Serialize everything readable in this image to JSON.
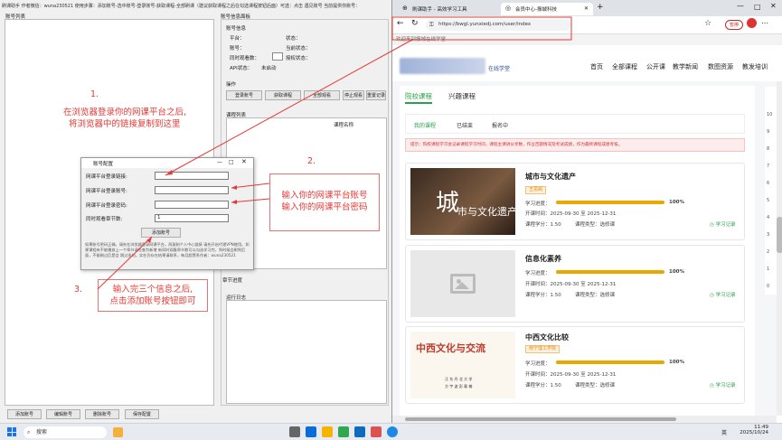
{
  "app": {
    "title": "刷课助手 作者微信：wuna230521  使用步骤：添加账号-选中账号-登录账号-获取课程-全部刷课（建议获取课程之后在勾选课程按钮后面）可选：点击 遇见账号 当前提供你账号：",
    "list_label": "账号列表",
    "settings_label": "账号信息面板",
    "info_label": "账号信息",
    "platform": "平台：",
    "account": "账号：",
    "sync_count": "同时观看数：",
    "api_status": "API状态：",
    "api_value": "未启动",
    "status": "状态：",
    "current_status": "当前状态：",
    "auth_status": "授权状态：",
    "ops_label": "操作",
    "ops": [
      "登录账号",
      "获取课程",
      "全部观看",
      "停止观看",
      "重置记录"
    ],
    "course_list_label": "课程列表",
    "course_name_col": "课程名称",
    "chapter_label": "章节进度",
    "log_label": "运行日志",
    "bottom_buttons": [
      "添加账号",
      "编辑账号",
      "删除账号",
      "保存配置"
    ]
  },
  "dialog": {
    "title": "账号配置",
    "fields": [
      "网课平台登录链接:",
      "网课平台登录账号:",
      "网课平台登录密码:",
      "同时观看章节数:"
    ],
    "chapter_value": "1",
    "add_button": "添加账号",
    "note": "如果账号密码正确，请先在浏览器登录网课平台，再复制个人中心链接  请先开启代理VPN使用。如果课程有不能播放上一个章节请检查为新增  新同时观看章节数可以勾选学习完，到时候会刷到后面，不能刷过后是会  跳过多的。实在仍存在结果请联系，每月超赞系作者：wuna230521"
  },
  "annotations": {
    "n1": "1.",
    "t1a": "在浏览器登录你的网课平台之后,",
    "t1b": "将浏览器中的链接复制到这里",
    "n2": "2.",
    "t2a": "输入你的网课平台账号",
    "t2b": "输入你的网课平台密码",
    "n3": "3.",
    "t3a": "输入完三个信息之后,",
    "t3b": "点击添加账号按钮即可"
  },
  "browser": {
    "tab1": "刷课助手 - 高效学习工具",
    "tab2": "会员中心-振城科技",
    "url": "https://bwgl.yunxiedj.com/user/index",
    "welcome": "欢迎来到振城在线学堂",
    "sync_badge": "暂停",
    "logo_suffix": "在线学堂",
    "nav": [
      "首页",
      "全部课程",
      "公开课",
      "教学新闻",
      "数图资源",
      "教发培训"
    ],
    "main_tabs": [
      "院校课程",
      "兴趣课程"
    ],
    "sub_tabs": [
      "我的课程",
      "已结束",
      "报名中"
    ],
    "notice": "提示：院校课程学习会记录课程学习时间，课程主课讲分享数，作业否题情况及考试成绩，作为最终课程成绩考核。",
    "courses": [
      {
        "title": "城市与文化遗产",
        "tag": "王思阁",
        "progress_label": "学习进度：",
        "progress": "100%",
        "time": "开课时间：2025-09-30 至 2025-12-31",
        "credit": "课程学分：1.50",
        "type": "课程类型：选修课",
        "record": "学习记录",
        "img_big": "城",
        "img_text": "市与文化遗产"
      },
      {
        "title": "信息化素养",
        "tag": "",
        "progress_label": "学习进度：",
        "progress": "100%",
        "time": "开课时间：2025-09-30 至 2025-12-31",
        "credit": "课程学分：1.50",
        "type": "课程类型：选修课",
        "record": "学习记录"
      },
      {
        "title": "中西文化比较",
        "tag": "南宁理工学院",
        "progress_label": "学习进度：",
        "progress": "100%",
        "time": "开课时间：2025-09-30 至 2025-12-31",
        "credit": "课程学分：1.50",
        "type": "课程类型：选修课",
        "record": "学习记录",
        "img_text": "中西文化与交流",
        "img_sub1": "汪 东 丹 北 大 学",
        "img_sub2": "方 宇 波   彭 载 楠"
      }
    ],
    "side_nums": [
      "10",
      "9",
      "8",
      "7",
      "6",
      "5",
      "4",
      "3",
      "2",
      "1",
      "0"
    ]
  },
  "taskbar": {
    "search": "搜索",
    "lang": "英",
    "time": "11:49",
    "date": "2025/10/24"
  },
  "progress": {
    "course1": 1.0,
    "course2": 1.0,
    "course3": 1.0
  },
  "colors": {
    "annotation": "#e53935",
    "accent": "#2aa24a",
    "bar": "#e9a800"
  }
}
